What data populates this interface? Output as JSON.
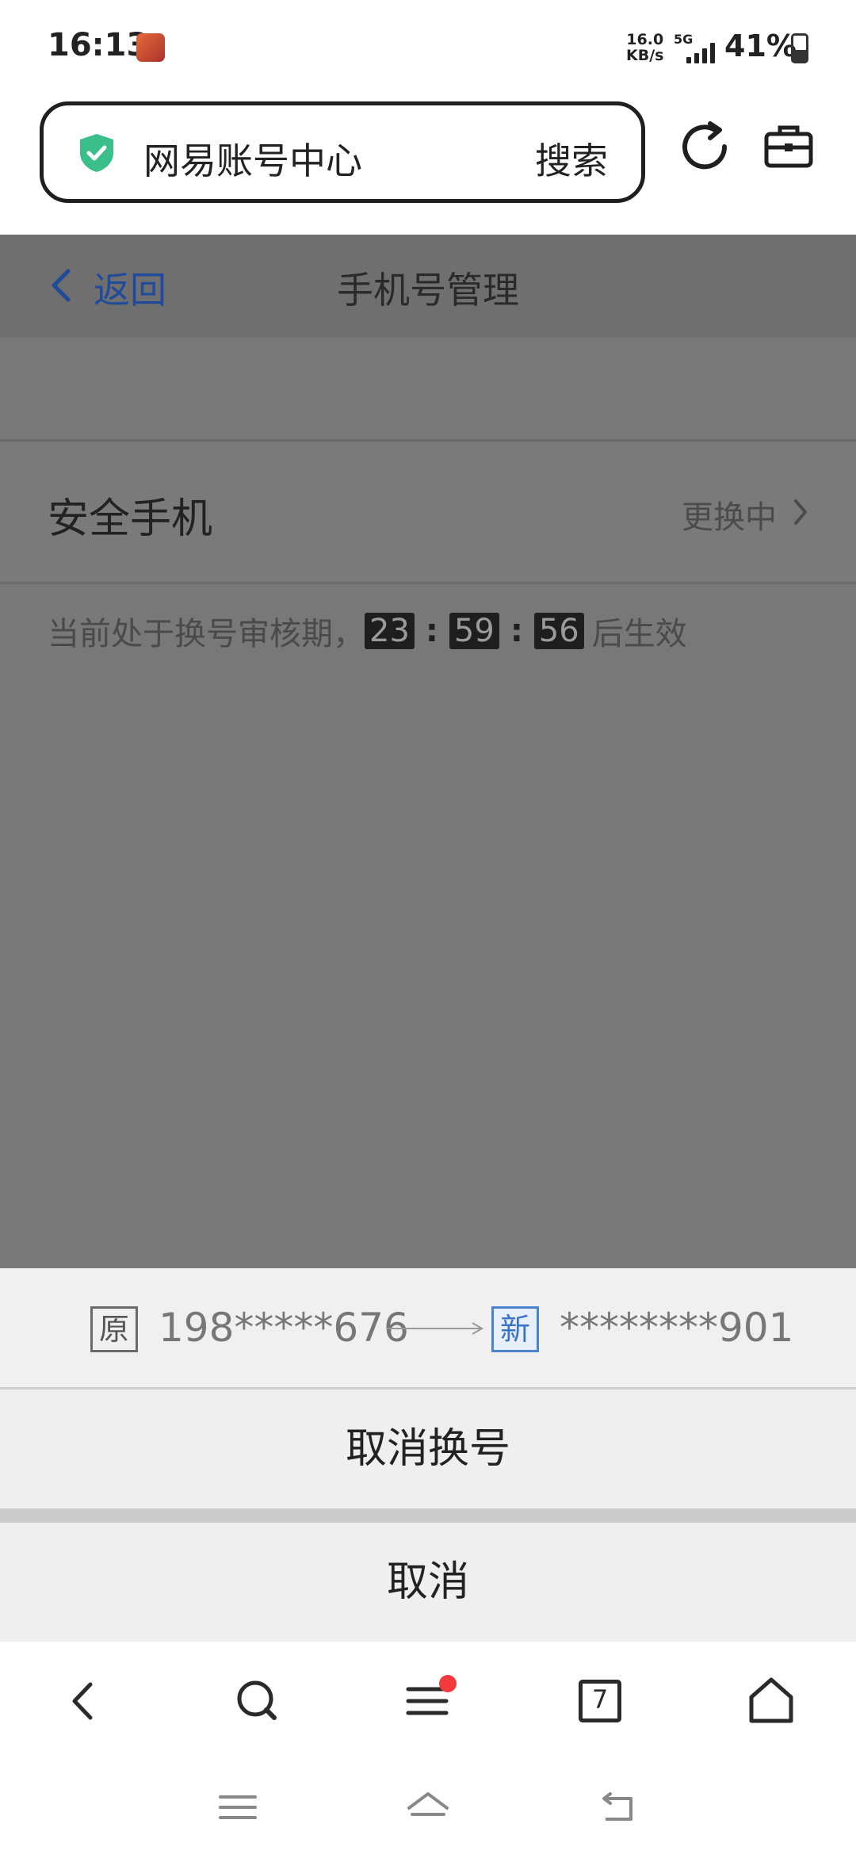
{
  "status_bar": {
    "time": "16:13",
    "net_speed_value": "16.0",
    "net_speed_unit": "KB/s",
    "network": "5G",
    "battery": "41%",
    "battery_level": 0.41
  },
  "browser": {
    "address_text": "网易账号中心",
    "search_label": "搜索",
    "icons": [
      "shield-check-icon",
      "reload-icon",
      "toolbox-icon"
    ]
  },
  "page": {
    "back_label": "返回",
    "title": "手机号管理",
    "row_title": "安全手机",
    "row_status": "更换中",
    "notice_prefix": "当前处于换号审核期，",
    "countdown": {
      "hours": "23",
      "minutes": "59",
      "seconds": "56",
      "sep": ":"
    },
    "notice_suffix": "后生效"
  },
  "sheet": {
    "old_tag": "原",
    "old_number": "198*****676",
    "new_tag": "新",
    "new_number": "********901",
    "cancel_change_label": "取消换号",
    "cancel_label": "取消"
  },
  "toolbar": {
    "tab_count": "7",
    "icons": [
      "back-arrow-icon",
      "search-icon",
      "menu-icon",
      "tabs-icon",
      "home-icon"
    ],
    "notification_color": "#f23a3a"
  },
  "colors": {
    "accent_blue": "#1f4b9a",
    "new_tag_blue": "#3a73c6",
    "shield_green": "#3bbf8a"
  }
}
